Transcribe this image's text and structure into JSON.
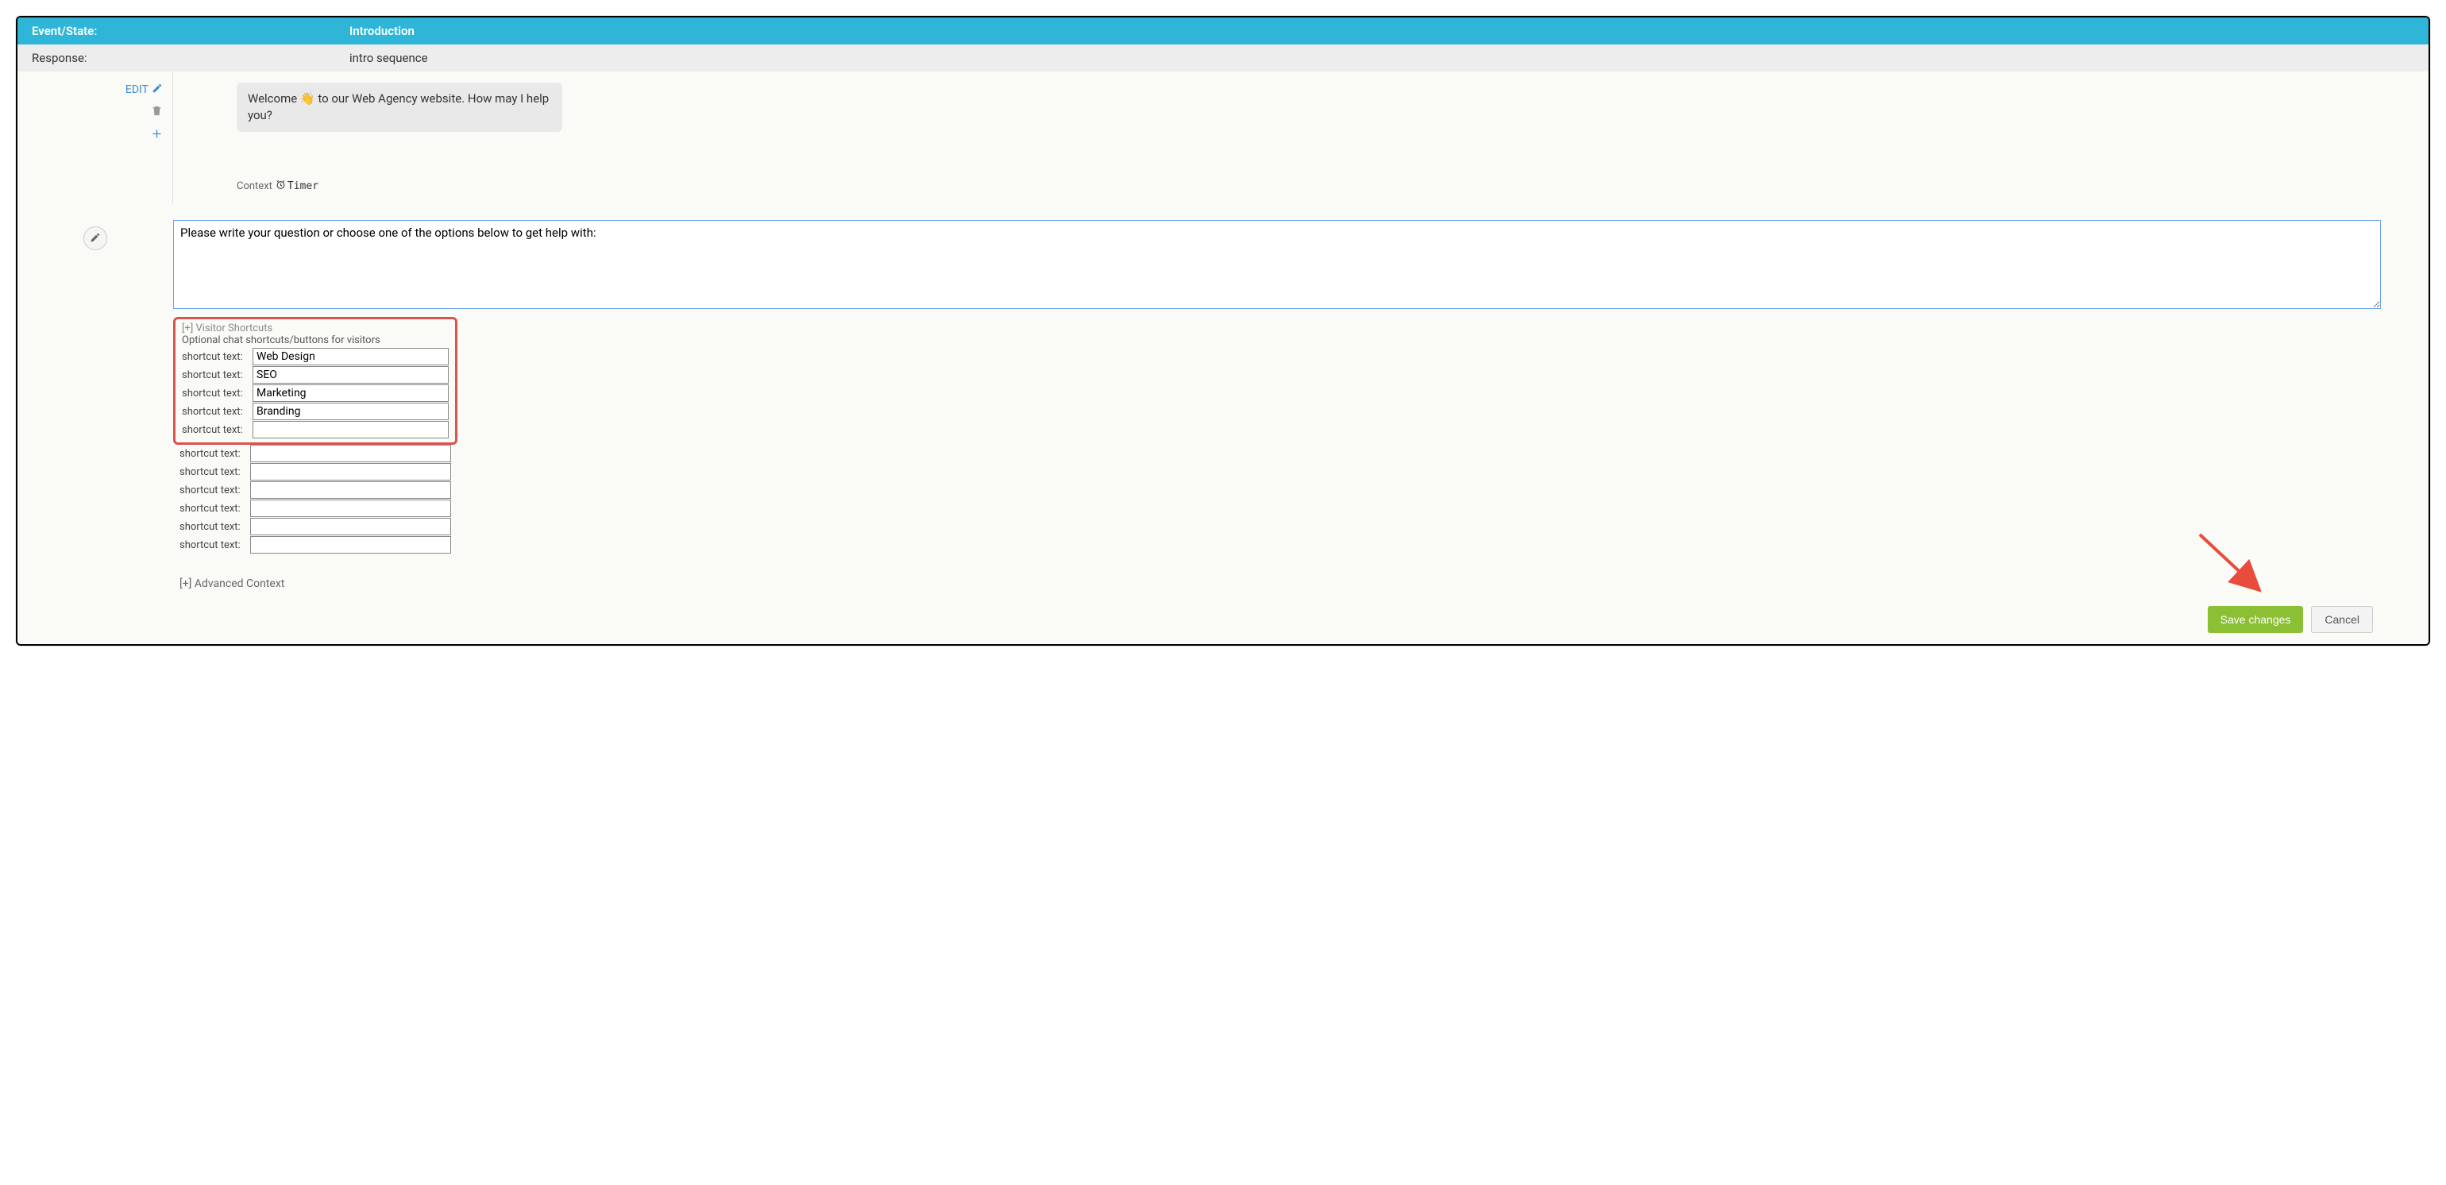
{
  "header": {
    "event_label": "Event/State:",
    "event_value": "Introduction",
    "response_label": "Response:",
    "response_value": "intro sequence"
  },
  "sidebar": {
    "edit_label": "EDIT"
  },
  "chat": {
    "welcome_pre": "Welcome ",
    "welcome_post": " to our Web Agency website. How may I help you?",
    "context_label": "Context",
    "timer_label": "Timer"
  },
  "editor": {
    "textarea_value": "Please write your question or choose one of the options below to get help with:"
  },
  "shortcuts": {
    "title": "[+] Visitor Shortcuts",
    "desc": "Optional chat shortcuts/buttons for visitors",
    "label": "shortcut text:",
    "values": [
      "Web Design",
      "SEO",
      "Marketing",
      "Branding",
      "",
      "",
      "",
      "",
      "",
      "",
      ""
    ]
  },
  "advanced": {
    "label": "[+] Advanced Context"
  },
  "buttons": {
    "save": "Save changes",
    "cancel": "Cancel"
  }
}
